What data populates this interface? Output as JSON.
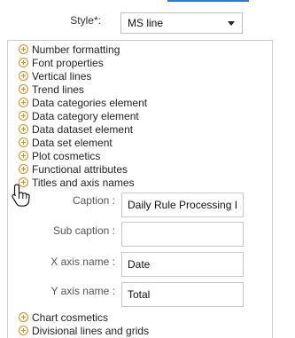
{
  "style": {
    "label": "Style*",
    "colon": ":",
    "selected": "MS line"
  },
  "sections_top": [
    "Number formatting",
    "Font properties",
    "Vertical lines",
    "Trend lines",
    "Data categories element",
    "Data category element",
    "Data dataset element",
    "Data set element",
    "Plot cosmetics",
    "Functional attributes",
    "Titles and axis names"
  ],
  "fields": {
    "caption": {
      "label": "Caption :",
      "value": "Daily Rule Processing Ir"
    },
    "subcaption": {
      "label": "Sub caption :",
      "value": ""
    },
    "xaxis": {
      "label": "X axis name :",
      "value": "Date"
    },
    "yaxis": {
      "label": "Y axis name :",
      "value": "Total"
    }
  },
  "sections_bottom": [
    "Chart cosmetics",
    "Divisional lines and grids"
  ]
}
